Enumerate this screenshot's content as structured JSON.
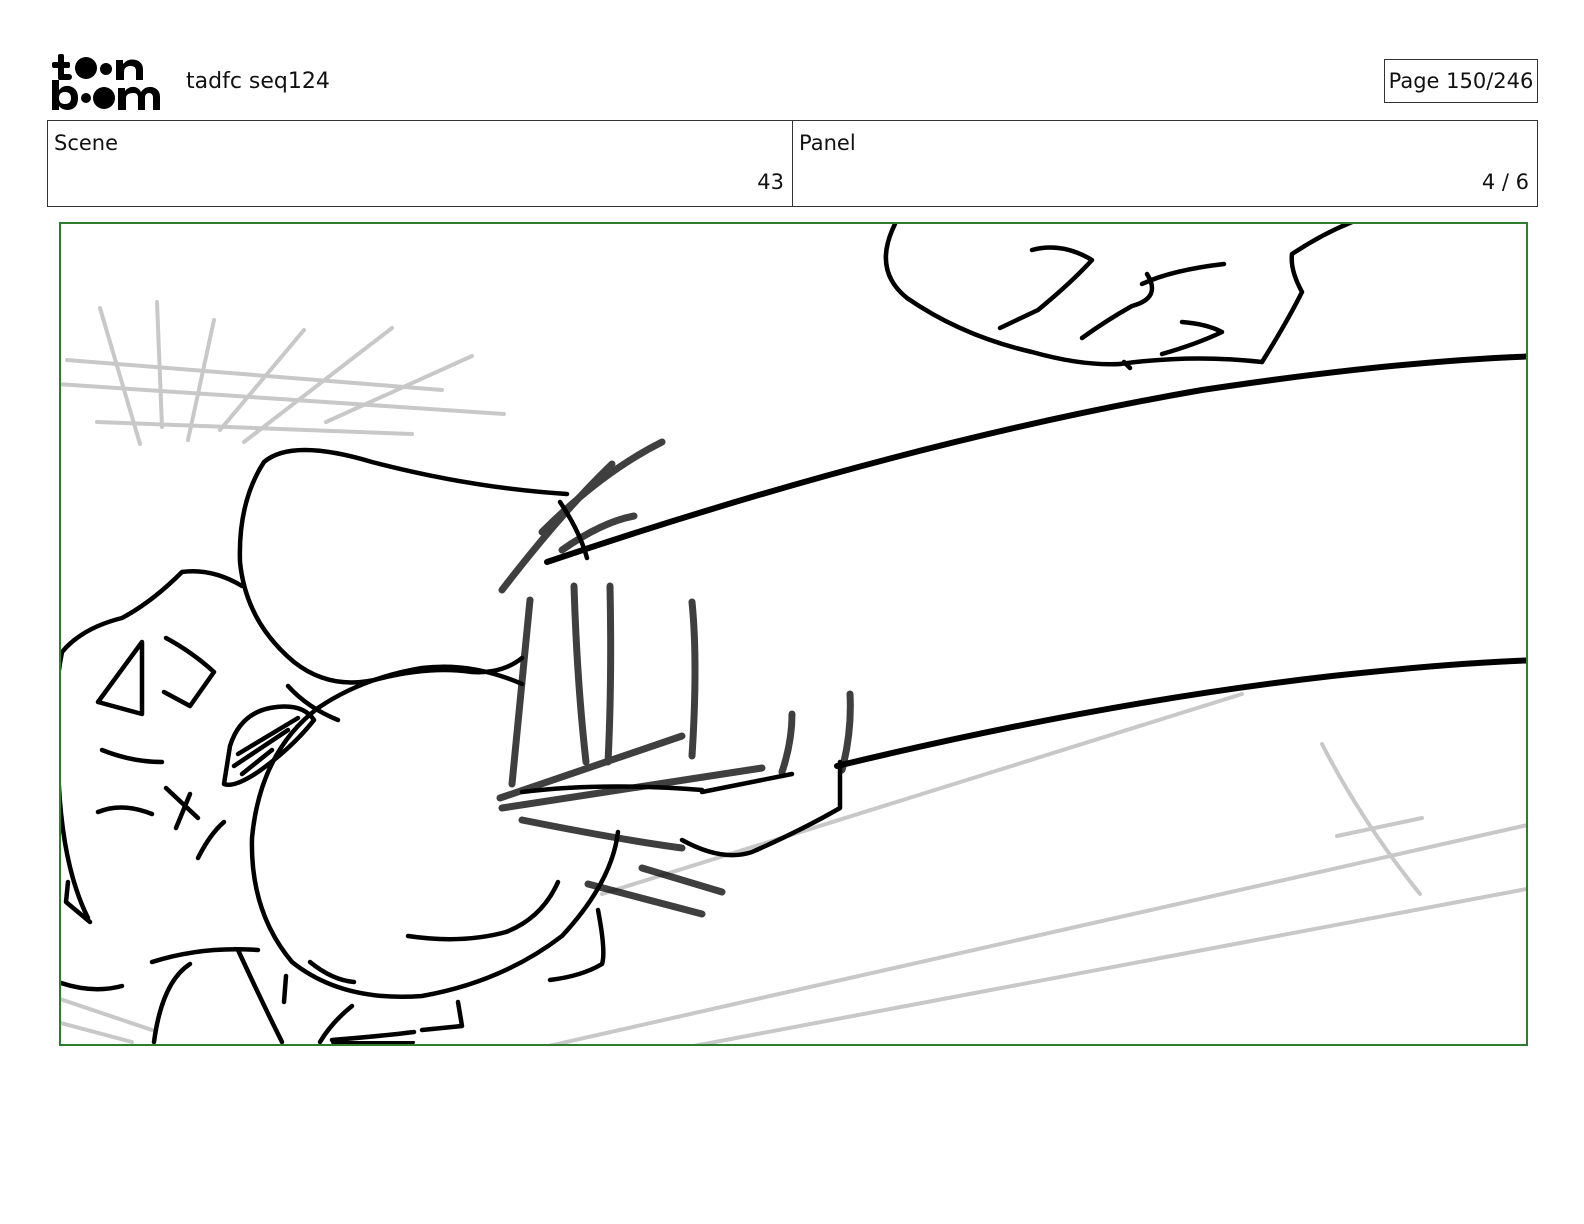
{
  "header": {
    "logo": {
      "line1": "toon",
      "line2": "boom"
    },
    "document_title": "tadfc seq124",
    "page_indicator": "Page 150/246"
  },
  "info": {
    "scene_label": "Scene",
    "scene_value": "43",
    "panel_label": "Panel",
    "panel_value": "4 / 6"
  },
  "frame": {
    "border_color": "#2e7d2e",
    "sketch_color": "#000000",
    "guide_color": "#c8c8c8"
  }
}
